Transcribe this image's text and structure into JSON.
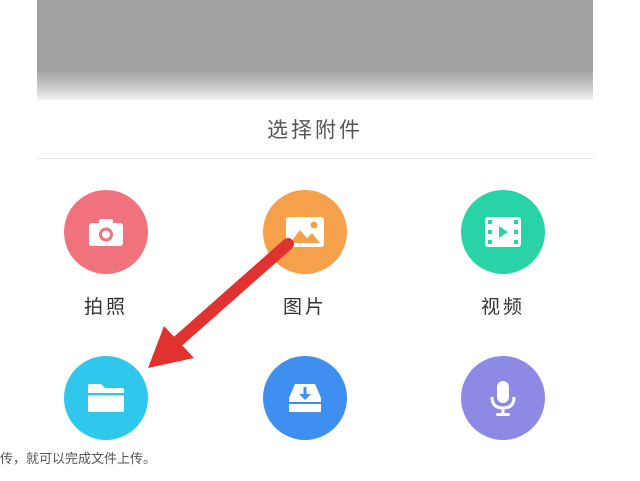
{
  "sheet": {
    "title": "选择附件"
  },
  "options": [
    {
      "label": "拍照",
      "icon": "camera-icon",
      "color": "#f0727d"
    },
    {
      "label": "图片",
      "icon": "image-icon",
      "color": "#f5a04a"
    },
    {
      "label": "视频",
      "icon": "video-icon",
      "color": "#2ad3a5"
    },
    {
      "label": "",
      "icon": "folder-icon",
      "color": "#2fc8ec"
    },
    {
      "label": "",
      "icon": "download-icon",
      "color": "#3f8ff0"
    },
    {
      "label": "",
      "icon": "microphone-icon",
      "color": "#8f89e6"
    }
  ],
  "annotation": {
    "arrow_color": "#e0322f"
  },
  "caption": {
    "text": "传，就可以完成文件上传。"
  }
}
